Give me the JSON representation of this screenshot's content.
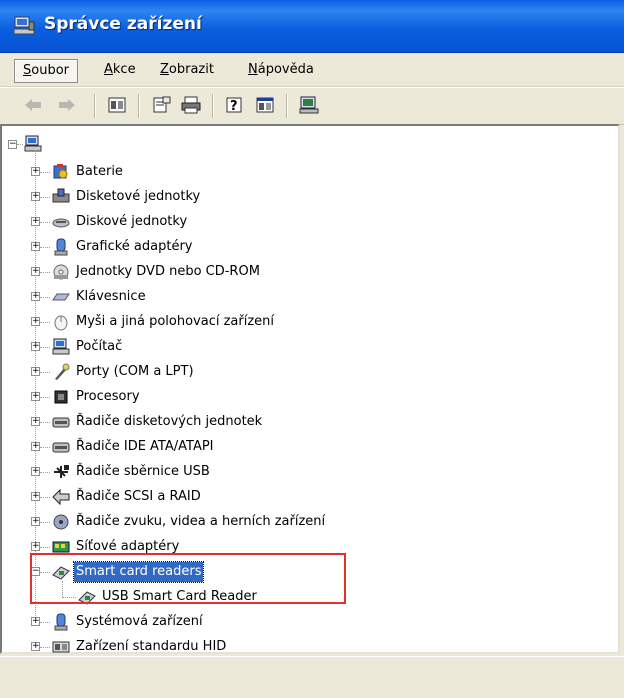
{
  "window": {
    "title": "Správce zařízení"
  },
  "menu": [
    {
      "label": "Soubor",
      "key": "S",
      "rest": "oubor"
    },
    {
      "label": "Akce",
      "key": "A",
      "rest": "kce"
    },
    {
      "label": "Zobrazit",
      "key": "Z",
      "rest": "obrazit"
    },
    {
      "label": "Nápověda",
      "key": "N",
      "rest": "ápověda"
    }
  ],
  "toolbar": {
    "buttons": [
      "back-icon",
      "forward-icon",
      "view-icon",
      "properties-icon",
      "print-icon",
      "help-icon",
      "console-icon",
      "computer-icon"
    ]
  },
  "tree": {
    "root": {
      "label": "",
      "icon": "computer-icon"
    },
    "items": [
      {
        "label": "Baterie",
        "icon": "battery-icon"
      },
      {
        "label": "Disketové jednotky",
        "icon": "floppy-drive-icon"
      },
      {
        "label": "Diskové jednotky",
        "icon": "disk-drive-icon"
      },
      {
        "label": "Grafické adaptéry",
        "icon": "display-adapter-icon"
      },
      {
        "label": "Jednotky DVD nebo CD-ROM",
        "icon": "cdrom-icon"
      },
      {
        "label": "Klávesnice",
        "icon": "keyboard-icon"
      },
      {
        "label": "Myši a jiná polohovací zařízení",
        "icon": "mouse-icon"
      },
      {
        "label": "Počítač",
        "icon": "computer-icon"
      },
      {
        "label": "Porty (COM a LPT)",
        "icon": "port-icon"
      },
      {
        "label": "Procesory",
        "icon": "processor-icon"
      },
      {
        "label": "Řadiče disketových jednotek",
        "icon": "controller-icon"
      },
      {
        "label": "Řadiče IDE ATA/ATAPI",
        "icon": "controller-icon"
      },
      {
        "label": "Řadiče sběrnice USB",
        "icon": "usb-icon"
      },
      {
        "label": "Řadiče SCSI a RAID",
        "icon": "scsi-icon"
      },
      {
        "label": "Řadiče zvuku, videa a herních zařízení",
        "icon": "sound-icon"
      },
      {
        "label": "Síťové adaptéry",
        "icon": "network-icon"
      },
      {
        "label": "Smart card readers",
        "icon": "smart-card-icon",
        "expanded": true,
        "selected": true,
        "children": [
          {
            "label": "USB Smart Card Reader",
            "icon": "smart-card-icon"
          }
        ]
      },
      {
        "label": "Systémová zařízení",
        "icon": "system-icon"
      },
      {
        "label": "Zařízení standardu HID",
        "icon": "hid-icon"
      }
    ]
  },
  "colors": {
    "titlebar": "#0a5ee6",
    "selection": "#316ac5",
    "highlight_box": "#e03030"
  }
}
